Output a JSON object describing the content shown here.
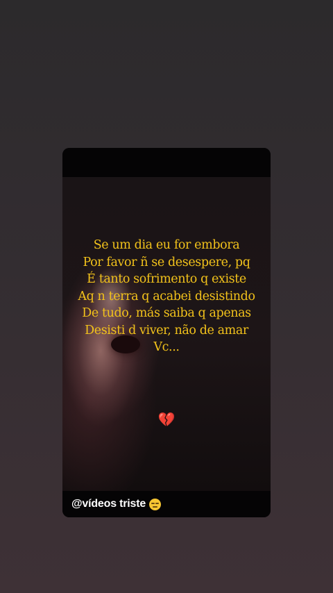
{
  "story": {
    "poem_lines": [
      "Se um dia eu for embora",
      "Por favor ñ se desespere, pq",
      "É tanto sofrimento q existe",
      "Aq n terra q acabei desistindo",
      "De tudo, más saiba q apenas",
      "Desisti d viver, não de amar",
      "Vc..."
    ],
    "heart_emoji": "💔",
    "handle": "@vídeos triste",
    "handle_emoji_icon": "pensive-face-icon",
    "text_color": "#f2c21b"
  }
}
